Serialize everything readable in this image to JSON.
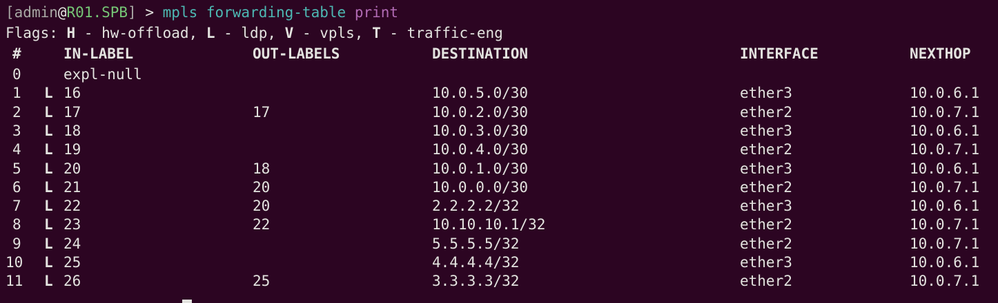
{
  "terminal": {
    "prompt": {
      "open_bracket": "[",
      "user": "admin",
      "at": "@",
      "host": "R01.SPB",
      "close_bracket": "]",
      "arrow": " > ",
      "command": "mpls forwarding-table",
      "command_arg": "print"
    },
    "flags": {
      "prefix": "Flags: ",
      "h_key": "H",
      "h_desc": " - hw-offload, ",
      "l_key": "L",
      "l_desc": " - ldp, ",
      "v_key": "V",
      "v_desc": " - vpls, ",
      "t_key": "T",
      "t_desc": " - traffic-eng"
    },
    "headers": {
      "num": "#",
      "in_label": "IN-LABEL",
      "out_labels": "OUT-LABELS",
      "destination": "DESTINATION",
      "interface": "INTERFACE",
      "nexthop": "NEXTHOP"
    },
    "rows": [
      {
        "num": "0",
        "flag": "",
        "in_label": "expl-null",
        "out_labels": "",
        "destination": "",
        "interface": "",
        "nexthop": ""
      },
      {
        "num": "1",
        "flag": "L",
        "in_label": "16",
        "out_labels": "",
        "destination": "10.0.5.0/30",
        "interface": "ether3",
        "nexthop": "10.0.6.1"
      },
      {
        "num": "2",
        "flag": "L",
        "in_label": "17",
        "out_labels": "17",
        "destination": "10.0.2.0/30",
        "interface": "ether2",
        "nexthop": "10.0.7.1"
      },
      {
        "num": "3",
        "flag": "L",
        "in_label": "18",
        "out_labels": "",
        "destination": "10.0.3.0/30",
        "interface": "ether3",
        "nexthop": "10.0.6.1"
      },
      {
        "num": "4",
        "flag": "L",
        "in_label": "19",
        "out_labels": "",
        "destination": "10.0.4.0/30",
        "interface": "ether2",
        "nexthop": "10.0.7.1"
      },
      {
        "num": "5",
        "flag": "L",
        "in_label": "20",
        "out_labels": "18",
        "destination": "10.0.1.0/30",
        "interface": "ether3",
        "nexthop": "10.0.6.1"
      },
      {
        "num": "6",
        "flag": "L",
        "in_label": "21",
        "out_labels": "20",
        "destination": "10.0.0.0/30",
        "interface": "ether2",
        "nexthop": "10.0.7.1"
      },
      {
        "num": "7",
        "flag": "L",
        "in_label": "22",
        "out_labels": "20",
        "destination": "2.2.2.2/32",
        "interface": "ether3",
        "nexthop": "10.0.6.1"
      },
      {
        "num": "8",
        "flag": "L",
        "in_label": "23",
        "out_labels": "22",
        "destination": "10.10.10.1/32",
        "interface": "ether2",
        "nexthop": "10.0.7.1"
      },
      {
        "num": "9",
        "flag": "L",
        "in_label": "24",
        "out_labels": "",
        "destination": "5.5.5.5/32",
        "interface": "ether2",
        "nexthop": "10.0.7.1"
      },
      {
        "num": "10",
        "flag": "L",
        "in_label": "25",
        "out_labels": "",
        "destination": "4.4.4.4/32",
        "interface": "ether3",
        "nexthop": "10.0.6.1"
      },
      {
        "num": "11",
        "flag": "L",
        "in_label": "26",
        "out_labels": "25",
        "destination": "3.3.3.3/32",
        "interface": "ether2",
        "nexthop": "10.0.7.1"
      }
    ],
    "colors": {
      "background": "#2c0522",
      "text": "#e3e3df",
      "host": "#76c776",
      "command": "#4db8b3",
      "argument": "#b26bb5"
    }
  }
}
